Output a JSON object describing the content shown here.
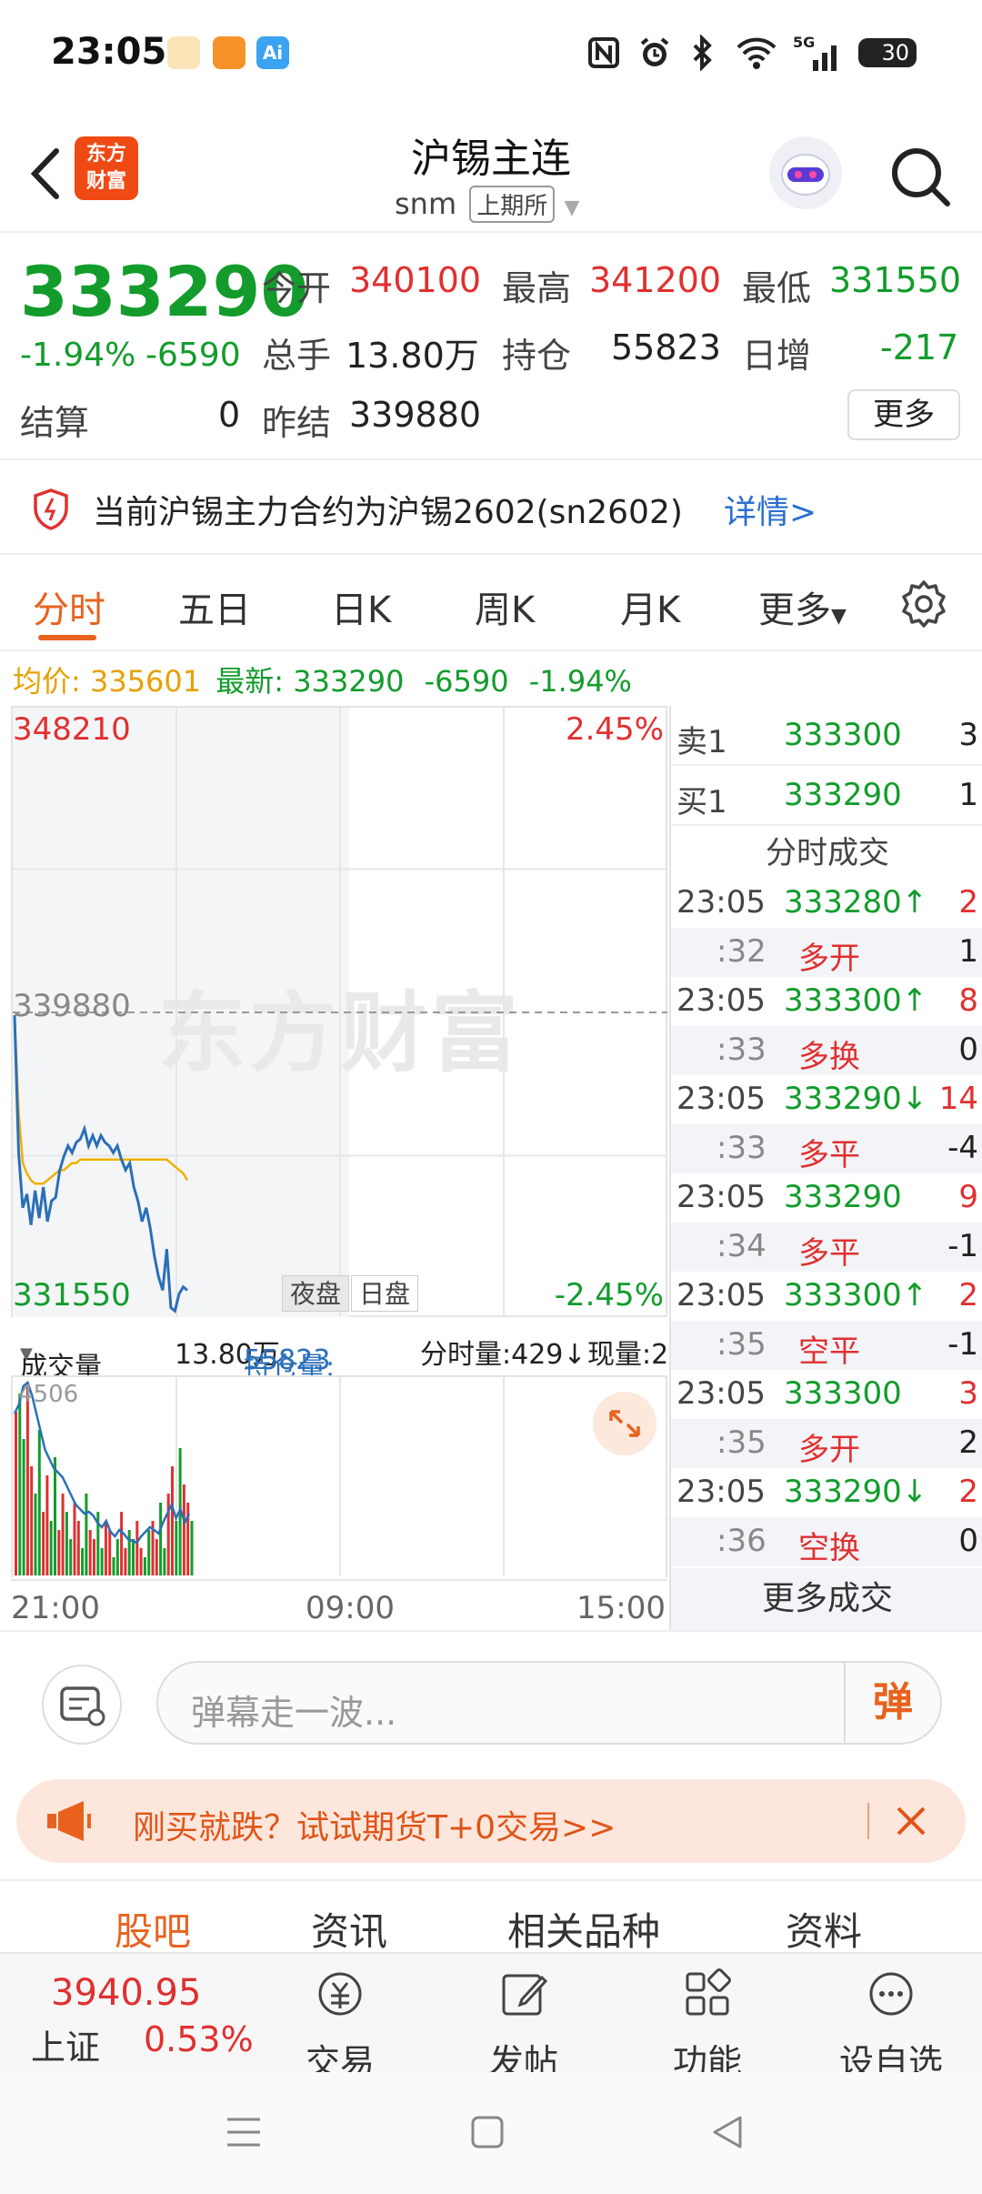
{
  "status_bar": {
    "time": "23:05",
    "battery": "30",
    "network": "5G"
  },
  "header": {
    "logo_line1": "东方",
    "logo_line2": "财富",
    "title": "沪锡主连",
    "code": "snm",
    "exchange": "上期所"
  },
  "quote": {
    "price": "333290",
    "change_pct": "-1.94%",
    "change": "-6590",
    "open_label": "今开",
    "open": "340100",
    "high_label": "最高",
    "high": "341200",
    "low_label": "最低",
    "low": "331550",
    "volume_label": "总手",
    "volume": "13.80万",
    "oi_label": "持仓",
    "oi": "55823",
    "daily_inc_label": "日增",
    "daily_inc": "-217",
    "settle_label": "结算",
    "settle": "0",
    "prev_settle_label": "昨结",
    "prev_settle": "339880",
    "more_label": "更多"
  },
  "notice": {
    "text": "当前沪锡主力合约为沪锡2602(sn2602)",
    "link": "详情>"
  },
  "tabs": [
    "分时",
    "五日",
    "日K",
    "周K",
    "月K",
    "更多"
  ],
  "avg_line": {
    "avg_label": "均价:",
    "avg": "335601",
    "latest_label": "最新:",
    "latest": "333290",
    "change": "-6590",
    "pct": "-1.94%"
  },
  "chart": {
    "y_top": "348210",
    "y_mid": "339880",
    "y_bottom": "331550",
    "pct_top": "2.45%",
    "pct_bottom": "-2.45%",
    "session_night": "夜盘",
    "session_day": "日盘",
    "watermark": "东方财富"
  },
  "chart_data": {
    "type": "line",
    "ylim": [
      331550,
      348210
    ],
    "reference": 339880,
    "x": [
      0,
      1,
      2,
      3,
      4,
      5,
      6,
      7,
      8,
      9,
      10,
      11,
      12,
      13,
      14,
      15,
      16,
      17,
      18,
      19,
      20,
      21,
      22,
      23,
      24,
      25,
      26,
      27,
      28,
      29,
      30,
      31,
      32,
      33,
      34,
      35,
      36,
      37,
      38,
      39,
      40,
      41,
      42
    ],
    "series": [
      {
        "values": [
          339800,
          335800,
          334200,
          334600,
          333700,
          334700,
          333900,
          334800,
          333800,
          334400,
          334500,
          335300,
          335700,
          336000,
          335800,
          336100,
          336200,
          336500,
          336000,
          336300,
          336000,
          336300,
          336100,
          336000,
          335800,
          336000,
          335600,
          335300,
          335500,
          334800,
          334400,
          333800,
          334200,
          333600,
          332800,
          332200,
          331800,
          333000,
          331300,
          331200,
          331700,
          331900,
          331800
        ],
        "color": "#2a6fb8"
      },
      {
        "values": [
          339800,
          337000,
          335500,
          335200,
          335000,
          334900,
          334900,
          334900,
          335000,
          335100,
          335200,
          335300,
          335300,
          335400,
          335500,
          335500,
          335600,
          335600,
          335600,
          335600,
          335600,
          335600,
          335600,
          335600,
          335600,
          335600,
          335600,
          335600,
          335600,
          335600,
          335600,
          335600,
          335600,
          335600,
          335600,
          335600,
          335600,
          335600,
          335500,
          335400,
          335300,
          335200,
          335000
        ],
        "color": "#f0b000"
      }
    ]
  },
  "volume_bar": {
    "label": "成交量",
    "volume": "13.80万",
    "oi_label": "持仓量:",
    "oi": "55823",
    "tick_label": "分时量:429↓",
    "now_label": "现量:2"
  },
  "volume_chart": {
    "max_label": "4506"
  },
  "x_labels": [
    "21:00",
    "09:00",
    "15:00"
  ],
  "order_book": [
    {
      "label": "卖1",
      "price": "333300",
      "qty": "3"
    },
    {
      "label": "买1",
      "price": "333290",
      "qty": "1"
    }
  ],
  "trades_title": "分时成交",
  "trades": [
    {
      "time": "23:05",
      "price": "333280↑",
      "qty": "2",
      "sec": ":32",
      "type": "多开",
      "oi": "1"
    },
    {
      "time": "23:05",
      "price": "333300↑",
      "qty": "8",
      "sec": ":33",
      "type": "多换",
      "oi": "0"
    },
    {
      "time": "23:05",
      "price": "333290↓",
      "qty": "14",
      "sec": ":33",
      "type": "多平",
      "oi": "-4"
    },
    {
      "time": "23:05",
      "price": "333290",
      "qty": "9",
      "sec": ":34",
      "type": "多平",
      "oi": "-1"
    },
    {
      "time": "23:05",
      "price": "333300↑",
      "qty": "2",
      "sec": ":35",
      "type": "空平",
      "oi": "-1"
    },
    {
      "time": "23:05",
      "price": "333300",
      "qty": "3",
      "sec": ":35",
      "type": "多开",
      "oi": "2"
    },
    {
      "time": "23:05",
      "price": "333290↓",
      "qty": "2",
      "sec": ":36",
      "type": "空换",
      "oi": "0"
    }
  ],
  "more_trades": "更多成交",
  "danmu": {
    "placeholder": "弹幕走一波...",
    "button": "弹"
  },
  "promo": {
    "text": "刚买就跌？试试期货T+0交易>>"
  },
  "sub_tabs": [
    "股吧",
    "资讯",
    "相关品种",
    "资料"
  ],
  "bottom_nav": {
    "index_value": "3940.95",
    "index_name": "上证",
    "index_pct": "0.53%",
    "items": [
      "交易",
      "发帖",
      "功能",
      "设自选"
    ]
  },
  "colors": {
    "up": "#e03030",
    "down": "#139c2c",
    "accent": "#e8621e",
    "link": "#2b6fcf"
  }
}
